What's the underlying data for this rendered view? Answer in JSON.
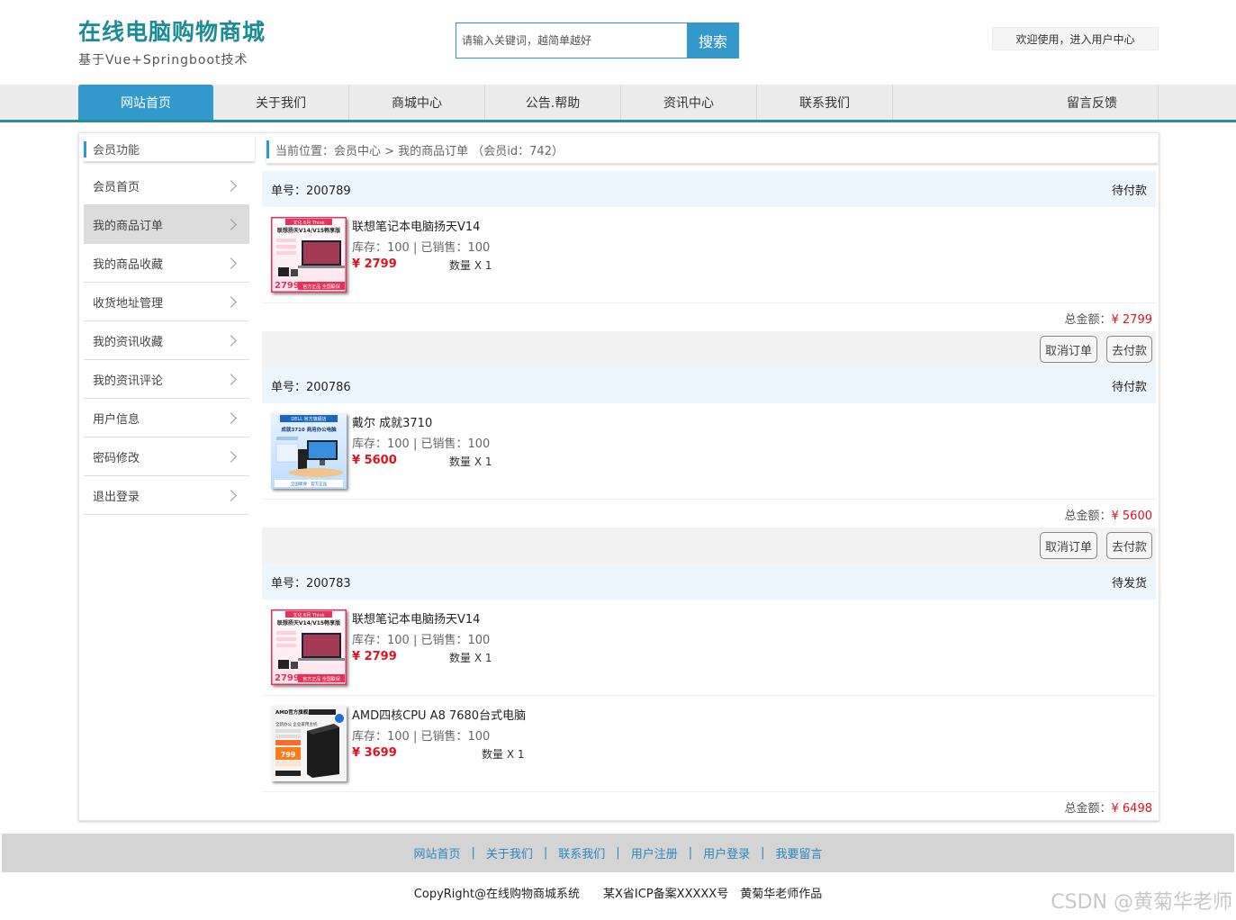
{
  "header": {
    "title": "在线电脑购物商城",
    "subtitle": "基于Vue+Springboot技术",
    "search_placeholder": "请输入关键词，越简单越好",
    "search_button": "搜索",
    "welcome": "欢迎使用，进入用户中心"
  },
  "nav": {
    "items": [
      "网站首页",
      "关于我们",
      "商城中心",
      "公告.帮助",
      "资讯中心",
      "联系我们",
      "留言反馈"
    ]
  },
  "sidebar": {
    "title": "会员功能",
    "items": [
      "会员首页",
      "我的商品订单",
      "我的商品收藏",
      "收货地址管理",
      "我的资讯收藏",
      "我的资讯评论",
      "用户信息",
      "密码修改",
      "退出登录"
    ]
  },
  "breadcrumb": "当前位置：会员中心 > 我的商品订单 （会员id：742）",
  "orders": [
    {
      "number": "单号：200789",
      "status": "待付款",
      "products": [
        {
          "name": "联想笔记本电脑扬天V14",
          "stock": "库存：100 | 已销售：100",
          "price": "¥ 2799",
          "qty": "数量 X 1",
          "thumb": "lenovo"
        }
      ],
      "total_label": "总金额：",
      "total": "¥ 2799",
      "buttons": [
        "取消订单",
        "去付款"
      ]
    },
    {
      "number": "单号：200786",
      "status": "待付款",
      "products": [
        {
          "name": "戴尔 成就3710",
          "stock": "库存：100 | 已销售：100",
          "price": "¥ 5600",
          "qty": "数量 X 1",
          "thumb": "dell"
        }
      ],
      "total_label": "总金额：",
      "total": "¥ 5600",
      "buttons": [
        "取消订单",
        "去付款"
      ]
    },
    {
      "number": "单号：200783",
      "status": "待发货",
      "products": [
        {
          "name": "联想笔记本电脑扬天V14",
          "stock": "库存：100 | 已销售：100",
          "price": "¥ 2799",
          "qty": "数量 X 1",
          "thumb": "lenovo"
        },
        {
          "name": "AMD四核CPU A8 7680台式电脑",
          "stock": "库存：100 | 已销售：100",
          "price": "¥ 3699",
          "qty": "数量 X 1",
          "thumb": "amd"
        }
      ],
      "total_label": "总金额：",
      "total": "¥ 6498",
      "buttons": []
    }
  ],
  "footer": {
    "links": [
      "网站首页",
      "关于我们",
      "联系我们",
      "用户注册",
      "用户登录",
      "我要留言"
    ],
    "copyright": "CopyRight@在线购物商城系统　　某X省ICP备案XXXXX号　黄菊华老师作品"
  },
  "watermark": "CSDN @黄菊华老师",
  "colors": {
    "brand": "#1a8c97",
    "accent": "#3399cc",
    "price": "#e4101e",
    "order_header_bg": "#eef6fd"
  },
  "thumbnails": {
    "lenovo": {
      "top_text": "文化 6月 Think",
      "headline": "联想扬天V14/V15畅享版",
      "price": "2799",
      "tag": "官方正品 全国联保"
    },
    "dell": {
      "top_text": "DELL 官方旗舰店",
      "headline": "成就3710 商用办公电脑",
      "tag": "全国联保 · 官方正品"
    },
    "amd": {
      "top_text": "AMD官方旗舰店",
      "headline": "全新办公 企业家用主机",
      "price": "799"
    }
  }
}
